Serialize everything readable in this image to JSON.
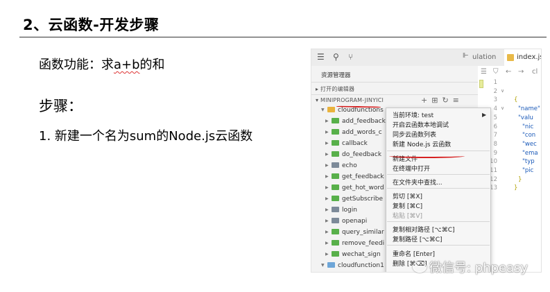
{
  "slide": {
    "title": "2、云函数-开发步骤",
    "func_prefix": "函数功能：求",
    "func_formula": "a+b",
    "func_suffix": "的和",
    "steps_heading": "步骤：",
    "step1": "1. 新建一个名为sum的Node.js云函数"
  },
  "topbar": {
    "tab_partial": "ulation",
    "tab_active": "index.js"
  },
  "sidebar": {
    "title": "资源管理器",
    "open_editors": "打开的编辑器",
    "project": "MINIPROGRAM-JINYICI",
    "tree": [
      {
        "label": "cloudfunctions",
        "color": "yellow",
        "indent": 1,
        "twisty": "▼"
      },
      {
        "label": "add_feedback",
        "color": "green",
        "indent": 2,
        "twisty": "▶"
      },
      {
        "label": "add_words_c",
        "color": "green",
        "indent": 2,
        "twisty": "▶"
      },
      {
        "label": "callback",
        "color": "green",
        "indent": 2,
        "twisty": "▶"
      },
      {
        "label": "do_feedback",
        "color": "green",
        "indent": 2,
        "twisty": "▶"
      },
      {
        "label": "echo",
        "color": "grey",
        "indent": 2,
        "twisty": "▶"
      },
      {
        "label": "get_feedback",
        "color": "green",
        "indent": 2,
        "twisty": "▶"
      },
      {
        "label": "get_hot_word",
        "color": "green",
        "indent": 2,
        "twisty": "▶"
      },
      {
        "label": "getSubscribe",
        "color": "green",
        "indent": 2,
        "twisty": "▶"
      },
      {
        "label": "login",
        "color": "grey",
        "indent": 2,
        "twisty": "▶"
      },
      {
        "label": "openapi",
        "color": "grey",
        "indent": 2,
        "twisty": "▶"
      },
      {
        "label": "query_similar",
        "color": "green",
        "indent": 2,
        "twisty": "▶"
      },
      {
        "label": "remove_feedi",
        "color": "green",
        "indent": 2,
        "twisty": "▶"
      },
      {
        "label": "wechat_sign",
        "color": "green",
        "indent": 2,
        "twisty": "▶"
      },
      {
        "label": "cloudfunction1",
        "color": "blue",
        "indent": 1,
        "twisty": "▼"
      }
    ]
  },
  "context_menu": {
    "items": [
      {
        "label": "当前环境: test",
        "submenu": true
      },
      {
        "label": "开启云函数本地调试"
      },
      {
        "label": "同步云函数列表"
      },
      {
        "label": "新建 Node.js 云函数"
      },
      {
        "label": "新建文件"
      },
      {
        "label": "在终端中打开"
      },
      {
        "label": "在文件夹中查找..."
      },
      {
        "label": "剪切  [⌘X]"
      },
      {
        "label": "复制  [⌘C]"
      },
      {
        "label": "粘贴  [⌘V]",
        "disabled": true
      },
      {
        "label": "复制相对路径  [⌥⌘C]"
      },
      {
        "label": "复制路径  [⌥⌘C]"
      },
      {
        "label": "重命名  [Enter]"
      },
      {
        "label": "删除  [⌘⌫]"
      }
    ]
  },
  "editor": {
    "line_numbers": [
      "1",
      "2",
      "3",
      "4",
      "5",
      "6",
      "7",
      "8",
      "9",
      "10",
      "11",
      "12",
      "13"
    ],
    "code_fragments": [
      "{",
      "\"name\"",
      "\"valu",
      "\"nic",
      "\"con",
      "\"wec",
      "\"ema",
      "\"typ",
      "\"pic",
      "}",
      "}"
    ]
  },
  "watermark": "微信号: phpeasy"
}
